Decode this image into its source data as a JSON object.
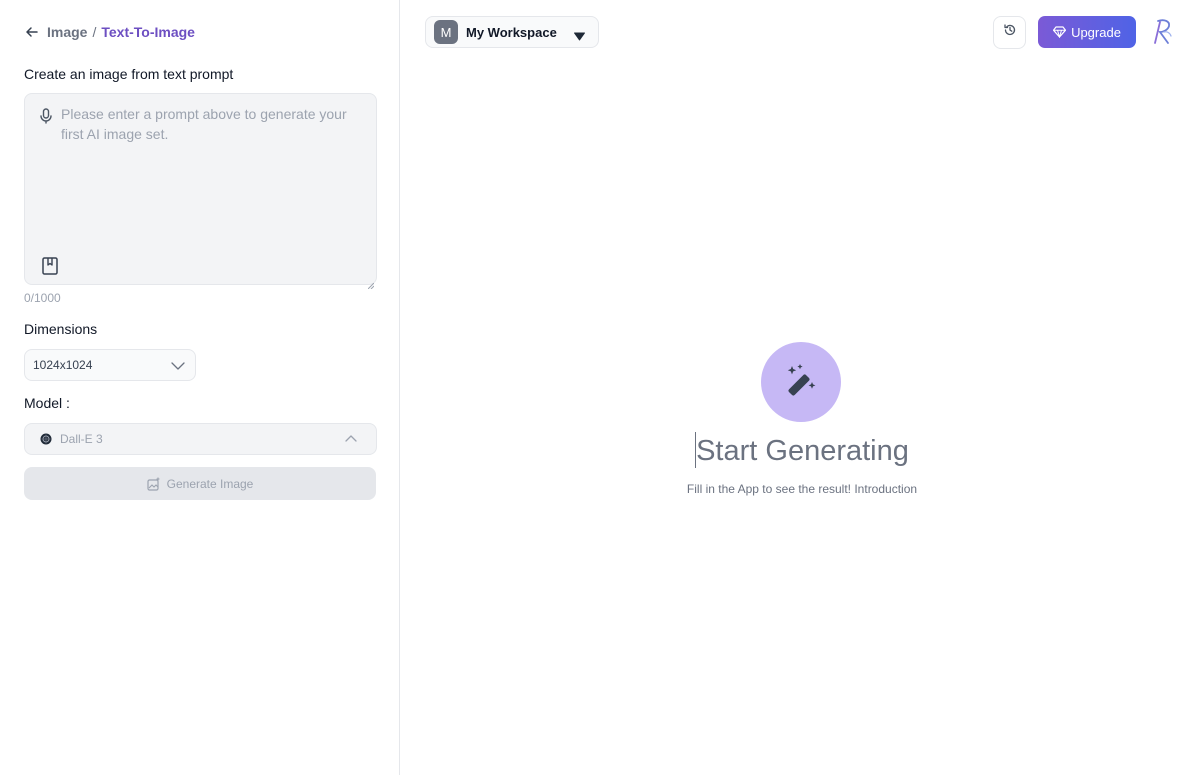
{
  "breadcrumb": {
    "root": "Image",
    "separator": "/",
    "current": "Text-To-Image"
  },
  "prompt_section": {
    "title": "Create an image from text prompt",
    "placeholder": "Please enter a prompt above to generate your first AI image set.",
    "value": "",
    "char_count": "0/1000"
  },
  "dimensions": {
    "label": "Dimensions",
    "selected": "1024x1024"
  },
  "model": {
    "label": "Model :",
    "selected": "Dall-E 3"
  },
  "generate_button": {
    "label": "Generate Image",
    "enabled": false
  },
  "header": {
    "workspace_initial": "M",
    "workspace_name": "My Workspace",
    "upgrade_label": "Upgrade"
  },
  "empty_state": {
    "title": "Start Generating",
    "subtitle": "Fill in the App to see the result! Introduction"
  },
  "icons": {
    "back": "arrow-left-icon",
    "mic": "microphone-icon",
    "bookmark": "bookmark-icon",
    "dropdown": "chevron-down-icon",
    "model_dropdown": "chevron-up-icon",
    "model_brand": "openai-icon",
    "generate": "image-sparkle-icon",
    "workspace_caret": "caret-down-icon",
    "history": "history-icon",
    "upgrade": "diamond-icon",
    "empty_state": "magic-wand-icon"
  },
  "colors": {
    "accent": "#6d4fc2",
    "upgrade_gradient_start": "#7b5ad6",
    "upgrade_gradient_end": "#4f63e6",
    "empty_icon_bg": "#c6b8f5",
    "disabled_button": "#e5e7eb"
  }
}
